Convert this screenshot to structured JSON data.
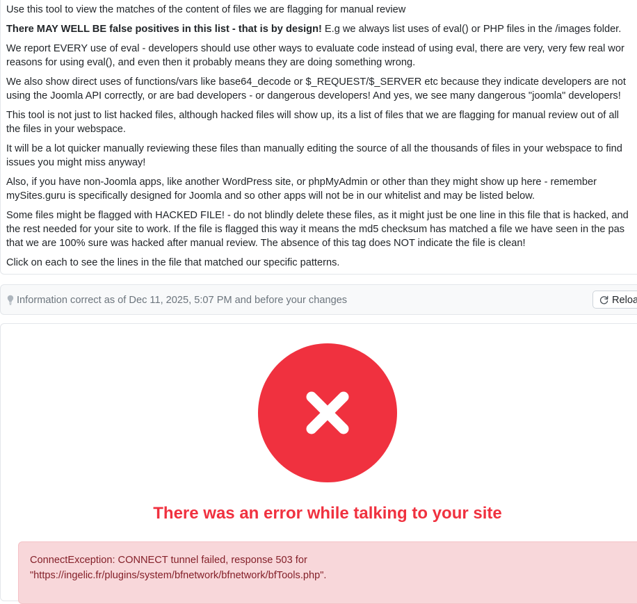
{
  "intro": {
    "line1": "Use this tool to view the matches of the content of files we are flagging for manual review",
    "line2_bold": "There MAY WELL BE false positives in this list - that is by design!",
    "line2_rest": " E.g we always list uses of eval() or PHP files in the /images folder.",
    "line3a": "We report EVERY use of eval - developers should use other ways to evaluate code instead of using eval, there are very, very few real wor",
    "line3b": "reasons for using eval(), and even then it probably means they are doing something wrong.",
    "line4a": "We also show direct uses of functions/vars like base64_decode or $_REQUEST/$_SERVER etc because they indicate developers are not",
    "line4b": "using the Joomla API correctly, or are bad developers - or dangerous developers! And yes, we see many dangerous \"joomla\" developers!",
    "line5a": "This tool is not just to list hacked files, although hacked files will show up, its a list of files that we are flagging for manual review out of all",
    "line5b": "the files in your webspace.",
    "line6a": "It will be a lot quicker manually reviewing these files than manually editing the source of all the thousands of files in your webspace to find",
    "line6b": "issues you might miss anyway!",
    "line7a": "Also, if you have non-Joomla apps, like another WordPress site, or phpMyAdmin or other than they might show up here - remember",
    "line7b": "mySites.guru is specifically designed for Joomla and so other apps will not be in our whitelist and may be listed below.",
    "line8a": "Some files might be flagged with HACKED FILE! - do not blindly delete these files, as it might just be one line in this file that is hacked, and",
    "line8b": "the rest needed for your site to work. If the file is flagged this way it means the md5 checksum has matched a file we have seen in the pas",
    "line8c": "that we are 100% sure was hacked after manual review. The absence of this tag does NOT indicate the file is clean!",
    "line9": "Click on each to see the lines in the file that matched our specific patterns."
  },
  "info_bar": {
    "icon": "lightbulb-icon",
    "text": "Information correct as of Dec 11, 2025, 5:07 PM and before your changes",
    "reload_icon": "refresh-icon",
    "reload_label": "Reload"
  },
  "error": {
    "icon": "x-circle-icon",
    "title": "There was an error while talking to your site",
    "message_line1": "ConnectException: CONNECT tunnel failed, response 503 for",
    "message_line2": "\"https://ingelic.fr/plugins/system/bfnetwork/bfnetwork/bfTools.php\"."
  },
  "colors": {
    "error_red": "#f0313f",
    "alert_bg": "#f8d7da",
    "alert_text": "#842029",
    "muted_text": "#6c757d"
  }
}
